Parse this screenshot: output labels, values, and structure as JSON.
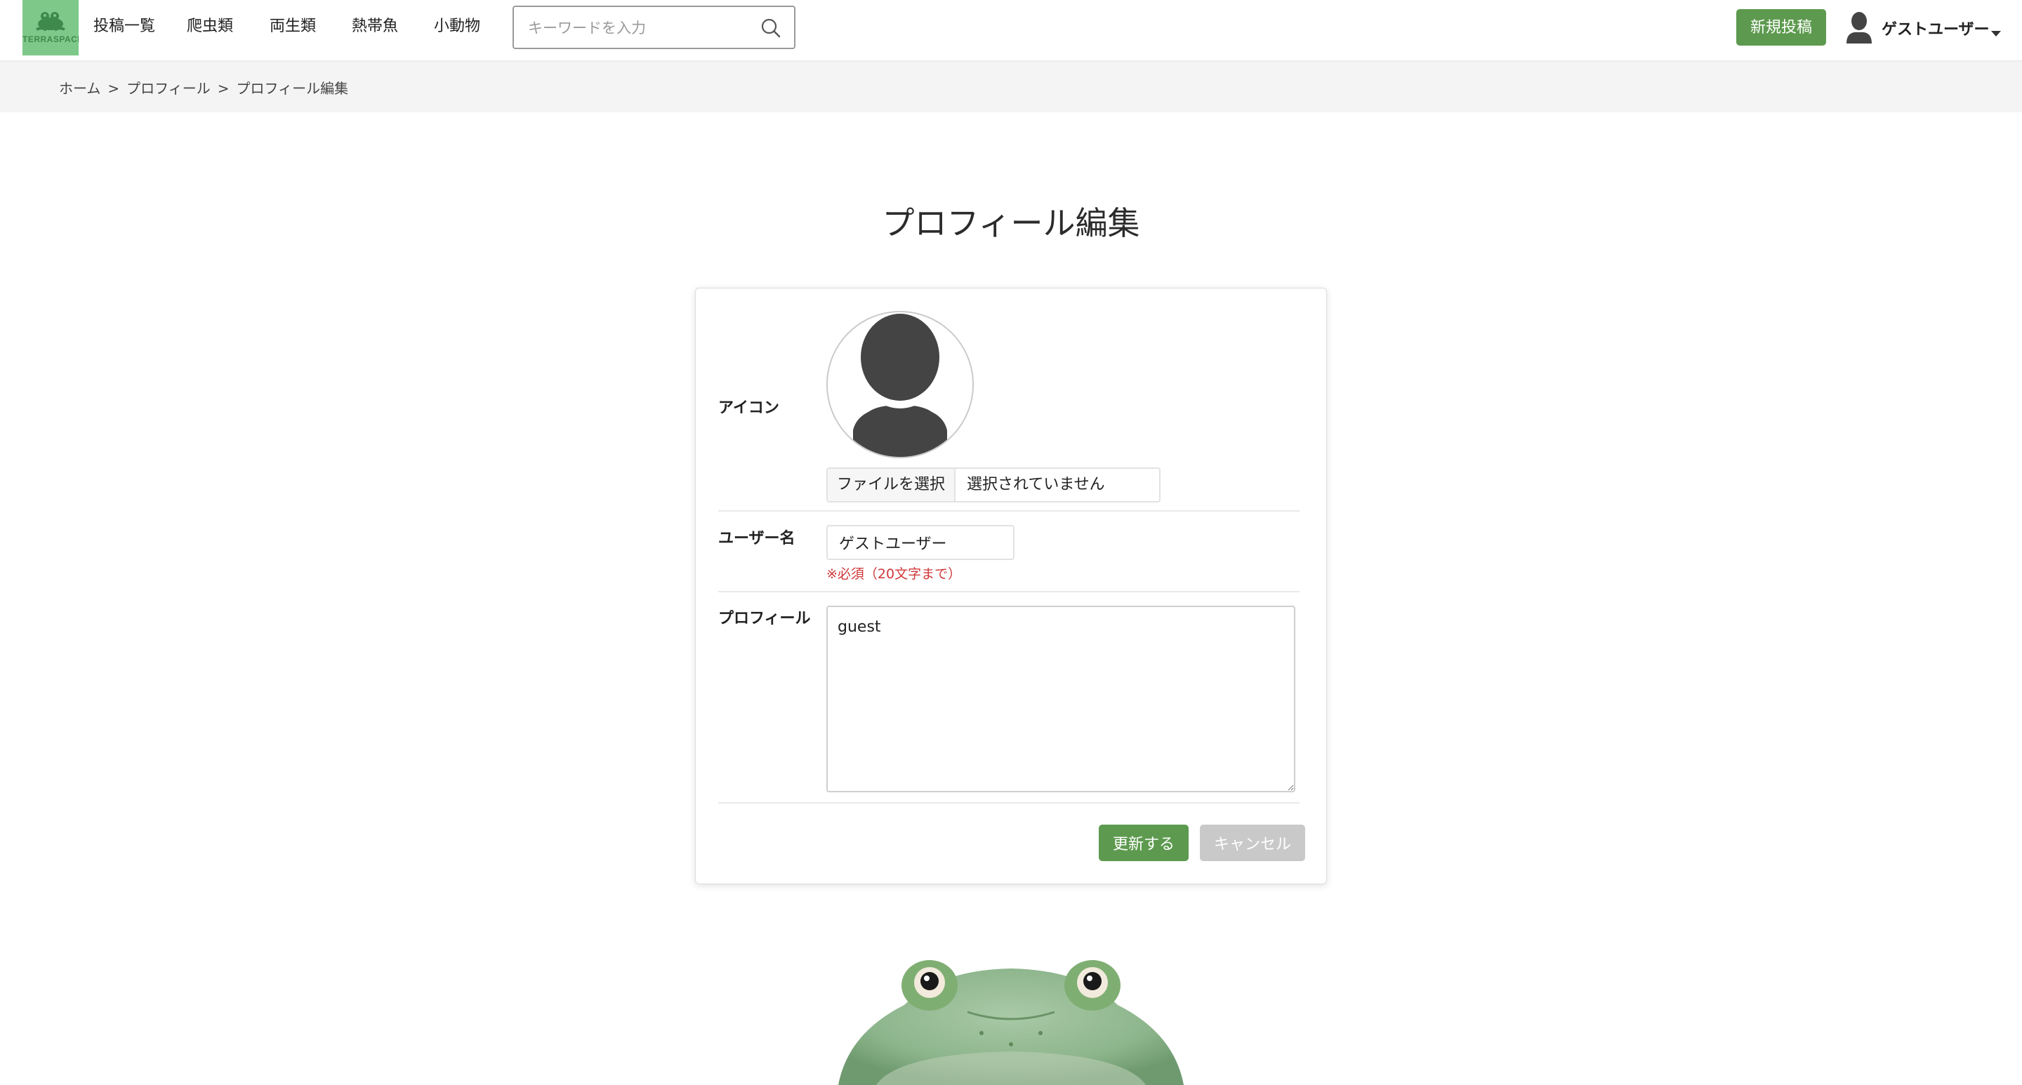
{
  "header": {
    "logo_text": "TERRASPACE",
    "nav": [
      "投稿一覧",
      "爬虫類",
      "両生類",
      "熱帯魚",
      "小動物"
    ],
    "search_placeholder": "キーワードを入力",
    "search_value": "",
    "new_post_label": "新規投稿",
    "user_name": "ゲストユーザー",
    "icons": {
      "search": "search-icon",
      "user": "user-avatar-icon",
      "dropdown": "caret-down-icon"
    }
  },
  "breadcrumb": {
    "items": [
      "ホーム",
      "プロフィール",
      "プロフィール編集"
    ],
    "separator": ">"
  },
  "page": {
    "title": "プロフィール編集"
  },
  "form": {
    "icon_label": "アイコン",
    "file_button_label": "ファイルを選択",
    "file_status": "選択されていません",
    "username_label": "ユーザー名",
    "username_value": "ゲストユーザー",
    "username_hint": "※必須（20文字まで）",
    "profile_label": "プロフィール",
    "profile_value": "guest",
    "submit_label": "更新する",
    "cancel_label": "キャンセル"
  },
  "colors": {
    "brand_green": "#5d9a4f",
    "logo_bg": "#7ec98a",
    "hint_red": "#d0383a",
    "cancel_gray": "#c9c9c9",
    "breadcrumb_bg": "#f4f4f4"
  }
}
